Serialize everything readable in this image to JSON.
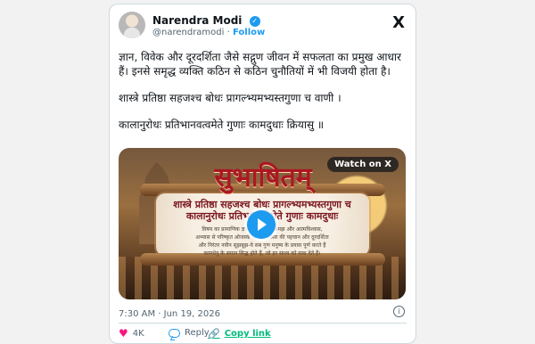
{
  "tweet": {
    "author_name": "Narendra Modi",
    "verified_symbol": "✓",
    "handle": "@narendramodi",
    "separator": "·",
    "follow_label": "Follow",
    "x_logo_text": "X",
    "text": {
      "paragraph_1": "ज्ञान, विवेक और दूरदर्शिता जैसे सद्गुण जीवन में सफलता का प्रमुख आधार हैं। इनसे समृद्ध व्यक्ति कठिन से कठिन चुनौतियों में भी विजयी होता है।",
      "paragraph_2": "शास्त्रे प्रतिष्ठा सहजश्च बोधः प्रागल्भ्यमभ्यस्तगुणा च वाणी ।",
      "paragraph_3": "कालानुरोधः प्रतिभानवत्वमेते गुणाः कामदुधाः क्रियासु ॥"
    },
    "media": {
      "watch_label": "Watch on X",
      "title": "सुभाषितम्",
      "shloka_line_1": "शास्त्रे प्रतिष्ठा सहजश्च बोधः प्रागल्भ्यमभ्यस्तगुणा च वाणी।",
      "shloka_line_2": "कालानुरोधः प्रतिभानवत्वमेते गुणाः कामदुधाः क्रियासु॥",
      "line_1": "विषय का प्रामाणिक ज्ञान, व्यवहारिक समझ और आत्मविश्वास,",
      "line_2": "अभ्यास से परिष्कृत ओजस्वी वाणी, अवसर की पहचान और दूरदर्शिता",
      "line_3": "और निरंतर नवीन सूझबूझ-ये सब गुण मनुष्य के प्रयास पूर्ण करते हैं",
      "line_4": "कामधेनु के समान सिद्ध होते हैं, जो हर साध्य को साध देते हैं।"
    },
    "timestamp": "7:30 AM · Jun 19, 2026",
    "actions": {
      "likes_count": "4K",
      "reply_label": "Reply",
      "copy_link_label": "Copy link"
    }
  }
}
